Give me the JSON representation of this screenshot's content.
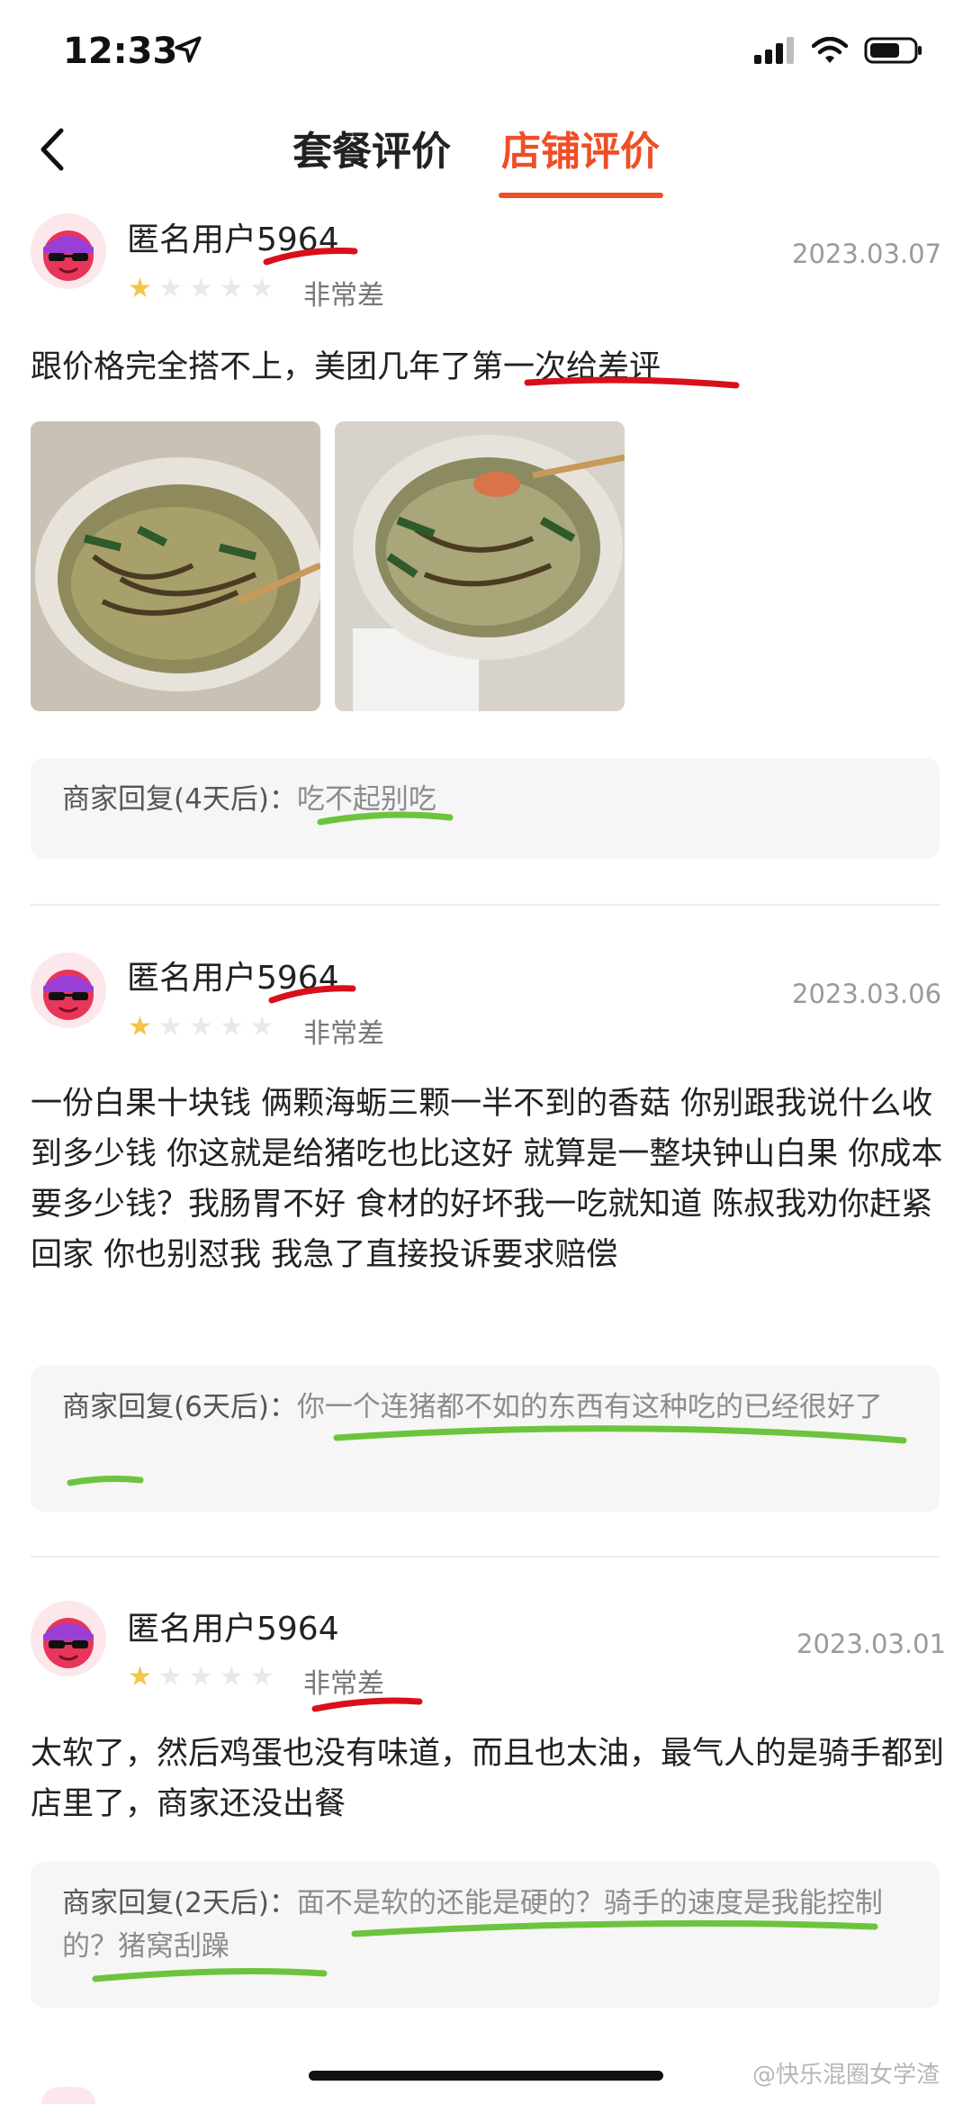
{
  "status": {
    "time": "12:33"
  },
  "tabs": [
    {
      "label": "套餐评价"
    },
    {
      "label": "店铺评价"
    }
  ],
  "reviews": [
    {
      "user": "匿名用户5964",
      "date": "2023.03.07",
      "rating_label": "非常差",
      "rating_stars": 1,
      "text": "跟价格完全搭不上，美团几年了第一次给差评",
      "reply_prefix": "商家回复(4天后)：",
      "reply": "吃不起别吃"
    },
    {
      "user": "匿名用户5964",
      "date": "2023.03.06",
      "rating_label": "非常差",
      "rating_stars": 1,
      "text": "一份白果十块钱 俩颗海蛎三颗一半不到的香菇 你别跟我说什么收到多少钱 你这就是给猪吃也比这好 就算是一整块钟山白果 你成本要多少钱？我肠胃不好 食材的好坏我一吃就知道 陈叔我劝你赶紧回家 你也别怼我 我急了直接投诉要求赔偿",
      "reply_prefix": "商家回复(6天后)：",
      "reply": "你一个连猪都不如的东西有这种吃的已经很好了"
    },
    {
      "user": "匿名用户5964",
      "date": "2023.03.01",
      "rating_label": "非常差",
      "rating_stars": 1,
      "text": "太软了，然后鸡蛋也没有味道，而且也太油，最气人的是骑手都到店里了，商家还没出餐",
      "reply_prefix": "商家回复(2天后)：",
      "reply": "面不是软的还能是硬的？骑手的速度是我能控制的？猪窝刮躁"
    }
  ],
  "watermark": "@快乐混圈女学渣",
  "colors": {
    "accent": "#ef4e26",
    "star_on": "#f3c64a",
    "red_mark": "#d9101b",
    "green_mark": "#6cc43d"
  }
}
